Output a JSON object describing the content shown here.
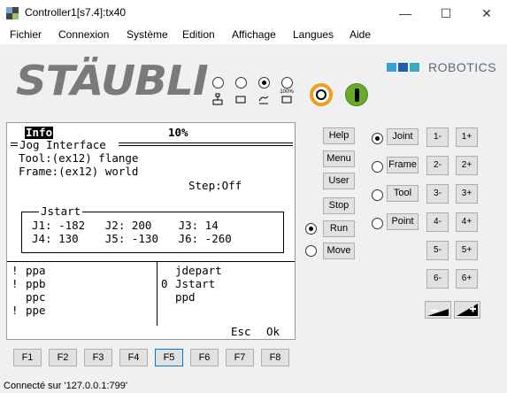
{
  "window": {
    "title": "Controller1[s7.4]:tx40",
    "minimize": "—",
    "maximize": "☐",
    "close": "✕"
  },
  "menu": [
    "Fichier",
    "Connexion",
    "Système",
    "Edition",
    "Affichage",
    "Langues",
    "Aide"
  ],
  "logo": {
    "brand": "STÄUBLI",
    "robotics": "ROBOTICS",
    "squares": [
      "#3ca0d8",
      "#1f5fb0",
      "#3da8c2"
    ]
  },
  "mode_selector": {
    "selected_index": 2,
    "labels": [
      "",
      "",
      "",
      "100%"
    ]
  },
  "power": {
    "ring_color": "#f29c1b",
    "enable_color": "#6aaa2a"
  },
  "screen": {
    "header_label": "Info",
    "speed": "10%",
    "panel_title": "Jog Interface",
    "tool_line": "Tool:(ex12) flange",
    "frame_line": "Frame:(ex12) world",
    "step_line": "Step:Off",
    "joints_title": "Jstart",
    "joints_row1": "J1: -182   J2: 200    J3: 14",
    "joints_row2": "J4: 130    J5: -130   J6: -260",
    "left_list": [
      {
        "mark": "!",
        "name": "ppa"
      },
      {
        "mark": "!",
        "name": "ppb"
      },
      {
        "mark": "",
        "name": "ppc"
      },
      {
        "mark": "!",
        "name": "ppe"
      }
    ],
    "right_list": [
      {
        "mark": "",
        "name": "jdepart"
      },
      {
        "mark": "0",
        "name": "Jstart"
      },
      {
        "mark": "",
        "name": "ppd"
      }
    ],
    "esc": "Esc",
    "ok": "Ok"
  },
  "fkeys": [
    "F1",
    "F2",
    "F3",
    "F4",
    "F5",
    "F6",
    "F7",
    "F8"
  ],
  "fkey_selected": "F5",
  "side_buttons": [
    "Help",
    "Menu",
    "User",
    "Stop"
  ],
  "run_move": {
    "run": "Run",
    "move": "Move",
    "selected": "Run"
  },
  "jog_frames": {
    "options": [
      "Joint",
      "Frame",
      "Tool",
      "Point"
    ],
    "selected": "Joint"
  },
  "jog_keys": [
    [
      "1-",
      "1+"
    ],
    [
      "2-",
      "2+"
    ],
    [
      "3-",
      "3+"
    ],
    [
      "4-",
      "4+"
    ],
    [
      "5-",
      "5+"
    ],
    [
      "6-",
      "6+"
    ]
  ],
  "status": "Connecté sur  '127.0.0.1:799'"
}
